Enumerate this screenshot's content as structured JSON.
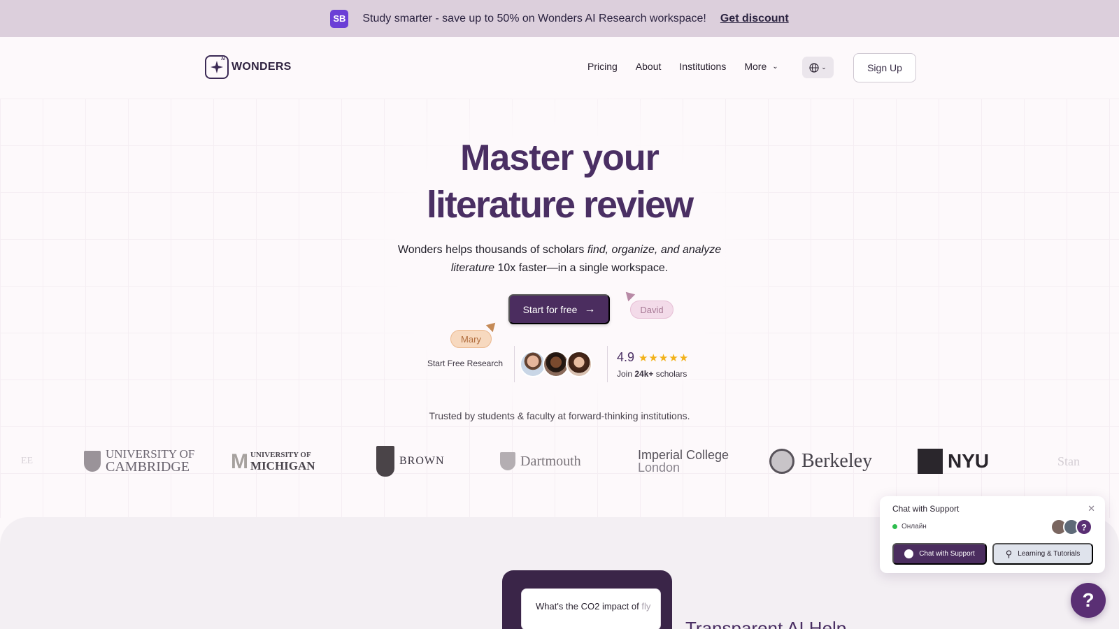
{
  "promo": {
    "badge": "SB",
    "text": "Study smarter - save up to 50% on Wonders AI Research workspace!",
    "link": "Get discount"
  },
  "header": {
    "logo_text": "WONDERS",
    "logo_badge": "AI",
    "nav": [
      {
        "label": "Pricing"
      },
      {
        "label": "About"
      },
      {
        "label": "Institutions"
      },
      {
        "label": "More"
      }
    ],
    "signup": "Sign Up"
  },
  "hero": {
    "line1": "Master your",
    "line2": "literature review",
    "sub_a": "Wonders helps thousands of scholars ",
    "sub_em": "find, organize, and analyze literature",
    "sub_b": " 10x faster—in a single workspace.",
    "cta": "Start for free",
    "cursor_mary": "Mary",
    "cursor_david": "David",
    "proof_left": "Start Free Research",
    "rating": "4.9",
    "stars": "★★★★★",
    "join_prefix": "Join ",
    "join_count": "24k+",
    "join_suffix": " scholars"
  },
  "trusted": "Trusted by students & faculty at forward-thinking institutions.",
  "institutions": {
    "ghost_left": "EE",
    "cambridge_1": "UNIVERSITY OF",
    "cambridge_2": "CAMBRIDGE",
    "michigan_1": "UNIVERSITY OF",
    "michigan_2": "MICHIGAN",
    "brown": "BROWN",
    "dartmouth": "Dartmouth",
    "imperial_1": "Imperial College",
    "imperial_2": "London",
    "berkeley": "Berkeley",
    "nyu": "NYU",
    "ghost_right": "Stan"
  },
  "demo": {
    "query_a": "What's the CO2 impact of ",
    "query_b": "fly",
    "section_title": "Transparent AI Help"
  },
  "chat": {
    "title": "Chat with Support",
    "status": "Онлайн",
    "btn_chat": "Chat with Support",
    "btn_learn": "Learning & Tutorials",
    "help": "?"
  },
  "colors": {
    "brand": "#4b2d5f",
    "banner": "#dccfdc",
    "star": "#f2b21b",
    "online": "#2ebd4e"
  },
  "icons": [
    "sparkle-icon",
    "chevron-down-icon",
    "globe-icon",
    "arrow-right-icon",
    "close-icon",
    "chat-bubble-icon",
    "search-icon",
    "help-icon"
  ]
}
